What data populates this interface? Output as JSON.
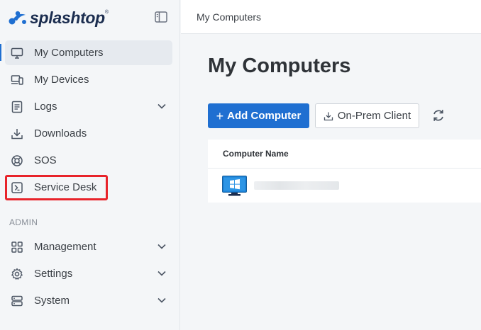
{
  "brand": {
    "name": "splashtop",
    "tm": "®"
  },
  "topbar": {
    "title": "My Computers"
  },
  "sidebar": {
    "items": [
      {
        "label": "My Computers"
      },
      {
        "label": "My Devices"
      },
      {
        "label": "Logs"
      },
      {
        "label": "Downloads"
      },
      {
        "label": "SOS"
      },
      {
        "label": "Service Desk"
      }
    ],
    "section_label": "ADMIN",
    "admin_items": [
      {
        "label": "Management"
      },
      {
        "label": "Settings"
      },
      {
        "label": "System"
      }
    ]
  },
  "main": {
    "page_title": "My Computers",
    "add_button_label": "Add Computer",
    "add_button_symbol": "+",
    "onprem_button_label": "On-Prem Client",
    "table": {
      "column_header": "Computer Name"
    }
  },
  "colors": {
    "accent": "#1f6fd1",
    "highlight": "#e8232a",
    "brand_text": "#1b2d4f"
  }
}
